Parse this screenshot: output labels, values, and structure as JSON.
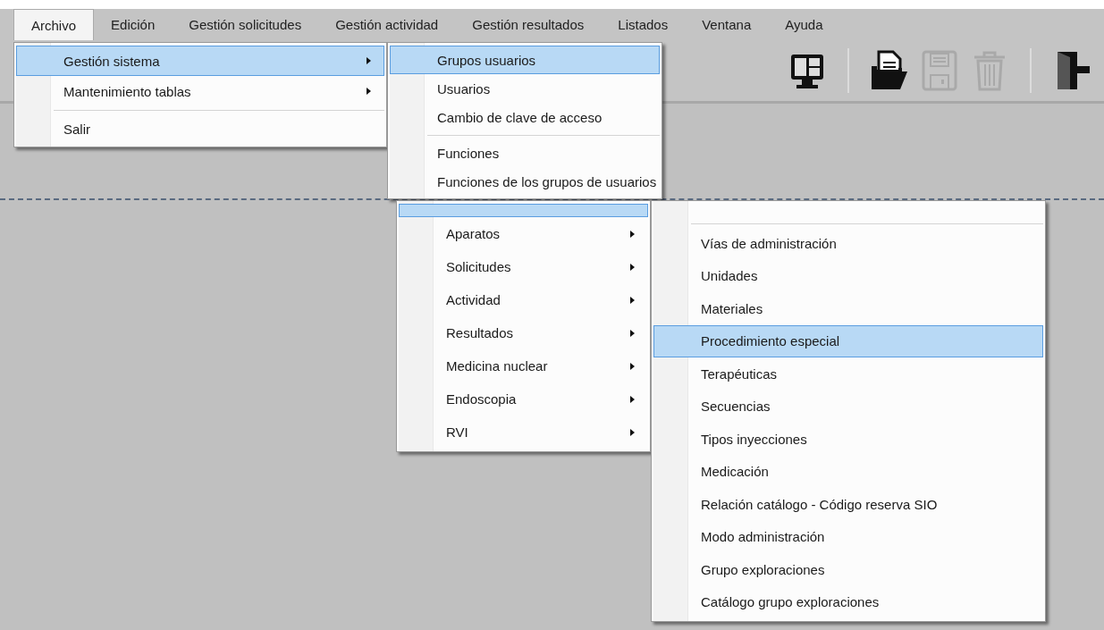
{
  "menubar": [
    {
      "label": "Archivo",
      "selected": true
    },
    {
      "label": "Edición",
      "selected": false
    },
    {
      "label": "Gestión solicitudes",
      "selected": false
    },
    {
      "label": "Gestión actividad",
      "selected": false
    },
    {
      "label": "Gestión resultados",
      "selected": false
    },
    {
      "label": "Listados",
      "selected": false
    },
    {
      "label": "Ventana",
      "selected": false
    },
    {
      "label": "Ayuda",
      "selected": false
    }
  ],
  "toolbar": [
    {
      "kind": "monitor",
      "disabled": false
    },
    {
      "kind": "separator"
    },
    {
      "kind": "open",
      "disabled": false
    },
    {
      "kind": "save",
      "disabled": true
    },
    {
      "kind": "delete",
      "disabled": true
    },
    {
      "kind": "separator"
    },
    {
      "kind": "exit",
      "disabled": false
    }
  ],
  "menus": [
    {
      "items": [
        {
          "kind": "item",
          "label": "Gestión sistema",
          "submenu": true,
          "selected": true
        },
        {
          "kind": "item",
          "label": "Mantenimiento tablas",
          "submenu": true,
          "selected": false
        },
        {
          "kind": "separator"
        },
        {
          "kind": "item",
          "label": "Salir",
          "submenu": false,
          "selected": false
        }
      ]
    },
    {
      "items": [
        {
          "kind": "item",
          "label": "Grupos usuarios",
          "submenu": false,
          "selected": true
        },
        {
          "kind": "item",
          "label": "Usuarios",
          "submenu": false,
          "selected": false
        },
        {
          "kind": "item",
          "label": "Cambio de clave de acceso",
          "submenu": false,
          "selected": false
        },
        {
          "kind": "separator"
        },
        {
          "kind": "item",
          "label": "Funciones",
          "submenu": false,
          "selected": false
        },
        {
          "kind": "item",
          "label": "Funciones de los grupos de usuarios",
          "submenu": false,
          "selected": false
        }
      ]
    },
    {
      "items": [
        {
          "kind": "covered",
          "selected": true
        },
        {
          "kind": "item",
          "label": "Aparatos",
          "submenu": true,
          "selected": false
        },
        {
          "kind": "item",
          "label": "Solicitudes",
          "submenu": true,
          "selected": false
        },
        {
          "kind": "item",
          "label": "Actividad",
          "submenu": true,
          "selected": false
        },
        {
          "kind": "item",
          "label": "Resultados",
          "submenu": true,
          "selected": false
        },
        {
          "kind": "item",
          "label": "Medicina nuclear",
          "submenu": true,
          "selected": false
        },
        {
          "kind": "item",
          "label": "Endoscopia",
          "submenu": true,
          "selected": false
        },
        {
          "kind": "item",
          "label": "RVI",
          "submenu": true,
          "selected": false
        }
      ]
    },
    {
      "items": [
        {
          "kind": "separator"
        },
        {
          "kind": "item",
          "label": "Vías de administración",
          "submenu": false,
          "selected": false
        },
        {
          "kind": "item",
          "label": "Unidades",
          "submenu": false,
          "selected": false
        },
        {
          "kind": "item",
          "label": "Materiales",
          "submenu": false,
          "selected": false
        },
        {
          "kind": "item",
          "label": "Procedimiento especial",
          "submenu": false,
          "selected": true
        },
        {
          "kind": "item",
          "label": "Terapéuticas",
          "submenu": false,
          "selected": false
        },
        {
          "kind": "item",
          "label": "Secuencias",
          "submenu": false,
          "selected": false
        },
        {
          "kind": "item",
          "label": "Tipos inyecciones",
          "submenu": false,
          "selected": false
        },
        {
          "kind": "item",
          "label": "Medicación",
          "submenu": false,
          "selected": false
        },
        {
          "kind": "item",
          "label": "Relación catálogo - Código reserva SIO",
          "submenu": false,
          "selected": false
        },
        {
          "kind": "item",
          "label": "Modo administración",
          "submenu": false,
          "selected": false
        },
        {
          "kind": "item",
          "label": "Grupo exploraciones",
          "submenu": false,
          "selected": false
        },
        {
          "kind": "item",
          "label": "Catálogo grupo exploraciones",
          "submenu": false,
          "selected": false
        }
      ]
    }
  ]
}
